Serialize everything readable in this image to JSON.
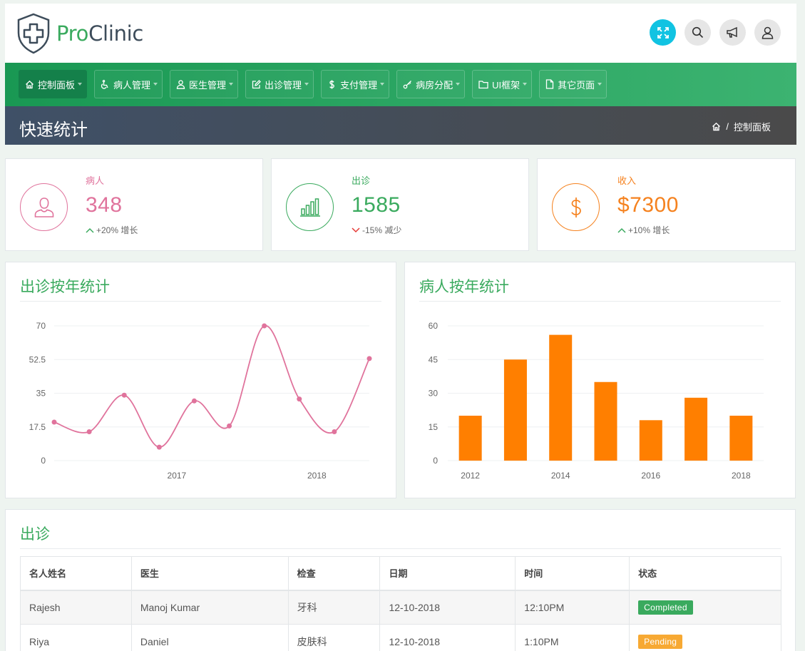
{
  "brand": {
    "pro": "Pro",
    "clinic": "Clinic"
  },
  "header_icons": [
    "expand-icon",
    "search-icon",
    "megaphone-icon",
    "user-icon"
  ],
  "nav": [
    {
      "label": "控制面板",
      "icon": "home-icon",
      "active": true
    },
    {
      "label": "病人管理",
      "icon": "wheelchair-icon",
      "active": false
    },
    {
      "label": "医生管理",
      "icon": "doctor-icon",
      "active": false
    },
    {
      "label": "出诊管理",
      "icon": "edit-icon",
      "active": false
    },
    {
      "label": "支付管理",
      "icon": "dollar-icon",
      "active": false
    },
    {
      "label": "病房分配",
      "icon": "key-icon",
      "active": false
    },
    {
      "label": "UI框架",
      "icon": "folder-icon",
      "active": false
    },
    {
      "label": "其它页面",
      "icon": "file-icon",
      "active": false
    }
  ],
  "page": {
    "title": "快速统计",
    "breadcrumb": "控制面板"
  },
  "stats": [
    {
      "label": "病人",
      "value": "348",
      "change": "+20% 增长",
      "trend": "up",
      "color": "#e0739c"
    },
    {
      "label": "出诊",
      "value": "1585",
      "change": "-15% 减少",
      "trend": "down",
      "color": "#3aaa5e"
    },
    {
      "label": "收入",
      "value": "$7300",
      "change": "+10% 增长",
      "trend": "up",
      "color": "#f5821f"
    }
  ],
  "line_chart_title": "出诊按年统计",
  "bar_chart_title": "病人按年统计",
  "chart_data": [
    {
      "type": "line",
      "title": "出诊按年统计",
      "color": "#e0739c",
      "x_tick_labels": [
        "2017",
        "2018"
      ],
      "y_ticks": [
        "0",
        "17.5",
        "35",
        "52.5",
        "70"
      ],
      "ylim": [
        0,
        70
      ],
      "values": [
        20,
        15,
        34,
        7,
        31,
        18,
        70,
        32,
        15,
        53
      ],
      "smooth": true,
      "grid": true
    },
    {
      "type": "bar",
      "title": "病人按年统计",
      "color": "#ff7f00",
      "x_tick_labels": [
        "2012",
        "2014",
        "2016",
        "2018"
      ],
      "y_ticks": [
        "0",
        "15",
        "30",
        "45",
        "60"
      ],
      "ylim": [
        0,
        60
      ],
      "values": [
        20,
        45,
        56,
        35,
        18,
        28,
        20
      ],
      "grid": true
    }
  ],
  "appointments": {
    "title": "出诊",
    "headers": [
      "名人姓名",
      "医生",
      "检查",
      "日期",
      "时间",
      "状态"
    ],
    "rows": [
      {
        "name": "Rajesh",
        "doctor": "Manoj Kumar",
        "check": "牙科",
        "date": "12-10-2018",
        "time": "12:10PM",
        "status": "Completed",
        "status_color": "#3aaa5e"
      },
      {
        "name": "Riya",
        "doctor": "Daniel",
        "check": "皮肤科",
        "date": "12-10-2018",
        "time": "1:10PM",
        "status": "Pending",
        "status_color": "#f7a933"
      }
    ]
  }
}
